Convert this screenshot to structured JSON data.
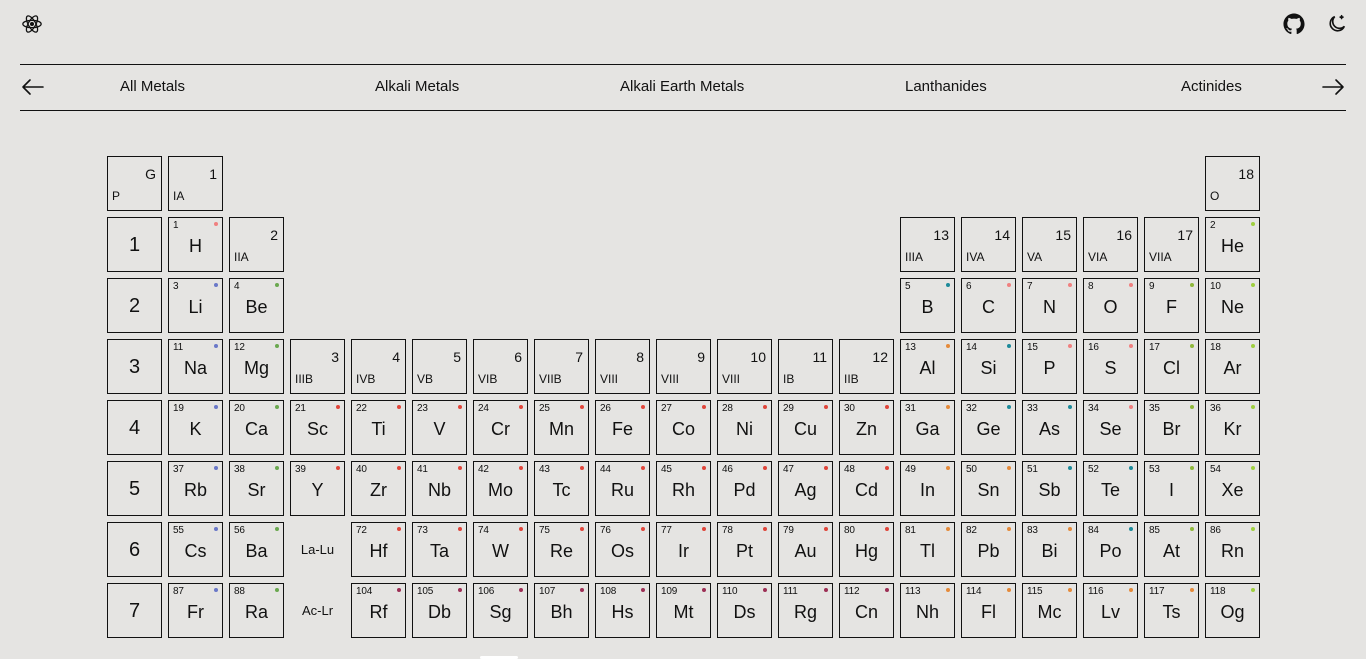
{
  "categories": [
    "All Metals",
    "Alkali Metals",
    "Alkali Earth Metals",
    "Lanthanides",
    "Actinides"
  ],
  "colors": {
    "alkali": "#6a78c8",
    "alkaline": "#6aa84f",
    "transition": "#e0453a",
    "post_transition": "#e58a3a",
    "metalloid": "#1d8a9a",
    "nonmetal": "#f08080",
    "halogen": "#8fb83a",
    "noble": "#9fcf3f",
    "superheavy": "#9c2f55"
  },
  "corner": {
    "top": "G",
    "bottom": "P"
  },
  "group_18_header": {
    "num": "18",
    "group": "O"
  },
  "group_headers": [
    {
      "num": "1",
      "group": "IA",
      "col": 1,
      "row": 0
    },
    {
      "num": "2",
      "group": "IIA",
      "col": 2,
      "row": 1
    },
    {
      "num": "3",
      "group": "IIIB",
      "col": 3,
      "row": 3
    },
    {
      "num": "4",
      "group": "IVB",
      "col": 4,
      "row": 3
    },
    {
      "num": "5",
      "group": "VB",
      "col": 5,
      "row": 3
    },
    {
      "num": "6",
      "group": "VIB",
      "col": 6,
      "row": 3
    },
    {
      "num": "7",
      "group": "VIIB",
      "col": 7,
      "row": 3
    },
    {
      "num": "8",
      "group": "VIII",
      "col": 8,
      "row": 3
    },
    {
      "num": "9",
      "group": "VIII",
      "col": 9,
      "row": 3
    },
    {
      "num": "10",
      "group": "VIII",
      "col": 10,
      "row": 3
    },
    {
      "num": "11",
      "group": "IB",
      "col": 11,
      "row": 3
    },
    {
      "num": "12",
      "group": "IIB",
      "col": 12,
      "row": 3
    },
    {
      "num": "13",
      "group": "IIIA",
      "col": 13,
      "row": 1
    },
    {
      "num": "14",
      "group": "IVA",
      "col": 14,
      "row": 1
    },
    {
      "num": "15",
      "group": "VA",
      "col": 15,
      "row": 1
    },
    {
      "num": "16",
      "group": "VIA",
      "col": 16,
      "row": 1
    },
    {
      "num": "17",
      "group": "VIIA",
      "col": 17,
      "row": 1
    }
  ],
  "periods": [
    "1",
    "2",
    "3",
    "4",
    "5",
    "6",
    "7"
  ],
  "range_labels": [
    {
      "label": "La-Lu",
      "col": 3,
      "row": 6
    },
    {
      "label": "Ac-Lr",
      "col": 3,
      "row": 7
    }
  ],
  "elements": [
    {
      "n": "1",
      "s": "H",
      "col": 1,
      "row": 1,
      "c": "nonmetal"
    },
    {
      "n": "2",
      "s": "He",
      "col": 18,
      "row": 1,
      "c": "noble"
    },
    {
      "n": "3",
      "s": "Li",
      "col": 1,
      "row": 2,
      "c": "alkali"
    },
    {
      "n": "4",
      "s": "Be",
      "col": 2,
      "row": 2,
      "c": "alkaline"
    },
    {
      "n": "5",
      "s": "B",
      "col": 13,
      "row": 2,
      "c": "metalloid"
    },
    {
      "n": "6",
      "s": "C",
      "col": 14,
      "row": 2,
      "c": "nonmetal"
    },
    {
      "n": "7",
      "s": "N",
      "col": 15,
      "row": 2,
      "c": "nonmetal"
    },
    {
      "n": "8",
      "s": "O",
      "col": 16,
      "row": 2,
      "c": "nonmetal"
    },
    {
      "n": "9",
      "s": "F",
      "col": 17,
      "row": 2,
      "c": "halogen"
    },
    {
      "n": "10",
      "s": "Ne",
      "col": 18,
      "row": 2,
      "c": "noble"
    },
    {
      "n": "11",
      "s": "Na",
      "col": 1,
      "row": 3,
      "c": "alkali"
    },
    {
      "n": "12",
      "s": "Mg",
      "col": 2,
      "row": 3,
      "c": "alkaline"
    },
    {
      "n": "13",
      "s": "Al",
      "col": 13,
      "row": 3,
      "c": "post_transition"
    },
    {
      "n": "14",
      "s": "Si",
      "col": 14,
      "row": 3,
      "c": "metalloid"
    },
    {
      "n": "15",
      "s": "P",
      "col": 15,
      "row": 3,
      "c": "nonmetal"
    },
    {
      "n": "16",
      "s": "S",
      "col": 16,
      "row": 3,
      "c": "nonmetal"
    },
    {
      "n": "17",
      "s": "Cl",
      "col": 17,
      "row": 3,
      "c": "halogen"
    },
    {
      "n": "18",
      "s": "Ar",
      "col": 18,
      "row": 3,
      "c": "noble"
    },
    {
      "n": "19",
      "s": "K",
      "col": 1,
      "row": 4,
      "c": "alkali"
    },
    {
      "n": "20",
      "s": "Ca",
      "col": 2,
      "row": 4,
      "c": "alkaline"
    },
    {
      "n": "21",
      "s": "Sc",
      "col": 3,
      "row": 4,
      "c": "transition"
    },
    {
      "n": "22",
      "s": "Ti",
      "col": 4,
      "row": 4,
      "c": "transition"
    },
    {
      "n": "23",
      "s": "V",
      "col": 5,
      "row": 4,
      "c": "transition"
    },
    {
      "n": "24",
      "s": "Cr",
      "col": 6,
      "row": 4,
      "c": "transition"
    },
    {
      "n": "25",
      "s": "Mn",
      "col": 7,
      "row": 4,
      "c": "transition"
    },
    {
      "n": "26",
      "s": "Fe",
      "col": 8,
      "row": 4,
      "c": "transition"
    },
    {
      "n": "27",
      "s": "Co",
      "col": 9,
      "row": 4,
      "c": "transition"
    },
    {
      "n": "28",
      "s": "Ni",
      "col": 10,
      "row": 4,
      "c": "transition"
    },
    {
      "n": "29",
      "s": "Cu",
      "col": 11,
      "row": 4,
      "c": "transition"
    },
    {
      "n": "30",
      "s": "Zn",
      "col": 12,
      "row": 4,
      "c": "transition"
    },
    {
      "n": "31",
      "s": "Ga",
      "col": 13,
      "row": 4,
      "c": "post_transition"
    },
    {
      "n": "32",
      "s": "Ge",
      "col": 14,
      "row": 4,
      "c": "metalloid"
    },
    {
      "n": "33",
      "s": "As",
      "col": 15,
      "row": 4,
      "c": "metalloid"
    },
    {
      "n": "34",
      "s": "Se",
      "col": 16,
      "row": 4,
      "c": "nonmetal"
    },
    {
      "n": "35",
      "s": "Br",
      "col": 17,
      "row": 4,
      "c": "halogen"
    },
    {
      "n": "36",
      "s": "Kr",
      "col": 18,
      "row": 4,
      "c": "noble"
    },
    {
      "n": "37",
      "s": "Rb",
      "col": 1,
      "row": 5,
      "c": "alkali"
    },
    {
      "n": "38",
      "s": "Sr",
      "col": 2,
      "row": 5,
      "c": "alkaline"
    },
    {
      "n": "39",
      "s": "Y",
      "col": 3,
      "row": 5,
      "c": "transition"
    },
    {
      "n": "40",
      "s": "Zr",
      "col": 4,
      "row": 5,
      "c": "transition"
    },
    {
      "n": "41",
      "s": "Nb",
      "col": 5,
      "row": 5,
      "c": "transition"
    },
    {
      "n": "42",
      "s": "Mo",
      "col": 6,
      "row": 5,
      "c": "transition"
    },
    {
      "n": "43",
      "s": "Tc",
      "col": 7,
      "row": 5,
      "c": "transition"
    },
    {
      "n": "44",
      "s": "Ru",
      "col": 8,
      "row": 5,
      "c": "transition"
    },
    {
      "n": "45",
      "s": "Rh",
      "col": 9,
      "row": 5,
      "c": "transition"
    },
    {
      "n": "46",
      "s": "Pd",
      "col": 10,
      "row": 5,
      "c": "transition"
    },
    {
      "n": "47",
      "s": "Ag",
      "col": 11,
      "row": 5,
      "c": "transition"
    },
    {
      "n": "48",
      "s": "Cd",
      "col": 12,
      "row": 5,
      "c": "transition"
    },
    {
      "n": "49",
      "s": "In",
      "col": 13,
      "row": 5,
      "c": "post_transition"
    },
    {
      "n": "50",
      "s": "Sn",
      "col": 14,
      "row": 5,
      "c": "post_transition"
    },
    {
      "n": "51",
      "s": "Sb",
      "col": 15,
      "row": 5,
      "c": "metalloid"
    },
    {
      "n": "52",
      "s": "Te",
      "col": 16,
      "row": 5,
      "c": "metalloid"
    },
    {
      "n": "53",
      "s": "I",
      "col": 17,
      "row": 5,
      "c": "halogen"
    },
    {
      "n": "54",
      "s": "Xe",
      "col": 18,
      "row": 5,
      "c": "noble"
    },
    {
      "n": "55",
      "s": "Cs",
      "col": 1,
      "row": 6,
      "c": "alkali"
    },
    {
      "n": "56",
      "s": "Ba",
      "col": 2,
      "row": 6,
      "c": "alkaline"
    },
    {
      "n": "72",
      "s": "Hf",
      "col": 4,
      "row": 6,
      "c": "transition"
    },
    {
      "n": "73",
      "s": "Ta",
      "col": 5,
      "row": 6,
      "c": "transition"
    },
    {
      "n": "74",
      "s": "W",
      "col": 6,
      "row": 6,
      "c": "transition"
    },
    {
      "n": "75",
      "s": "Re",
      "col": 7,
      "row": 6,
      "c": "transition"
    },
    {
      "n": "76",
      "s": "Os",
      "col": 8,
      "row": 6,
      "c": "transition"
    },
    {
      "n": "77",
      "s": "Ir",
      "col": 9,
      "row": 6,
      "c": "transition"
    },
    {
      "n": "78",
      "s": "Pt",
      "col": 10,
      "row": 6,
      "c": "transition"
    },
    {
      "n": "79",
      "s": "Au",
      "col": 11,
      "row": 6,
      "c": "transition"
    },
    {
      "n": "80",
      "s": "Hg",
      "col": 12,
      "row": 6,
      "c": "transition"
    },
    {
      "n": "81",
      "s": "Tl",
      "col": 13,
      "row": 6,
      "c": "post_transition"
    },
    {
      "n": "82",
      "s": "Pb",
      "col": 14,
      "row": 6,
      "c": "post_transition"
    },
    {
      "n": "83",
      "s": "Bi",
      "col": 15,
      "row": 6,
      "c": "post_transition"
    },
    {
      "n": "84",
      "s": "Po",
      "col": 16,
      "row": 6,
      "c": "metalloid"
    },
    {
      "n": "85",
      "s": "At",
      "col": 17,
      "row": 6,
      "c": "halogen"
    },
    {
      "n": "86",
      "s": "Rn",
      "col": 18,
      "row": 6,
      "c": "noble"
    },
    {
      "n": "87",
      "s": "Fr",
      "col": 1,
      "row": 7,
      "c": "alkali"
    },
    {
      "n": "88",
      "s": "Ra",
      "col": 2,
      "row": 7,
      "c": "alkaline"
    },
    {
      "n": "104",
      "s": "Rf",
      "col": 4,
      "row": 7,
      "c": "superheavy"
    },
    {
      "n": "105",
      "s": "Db",
      "col": 5,
      "row": 7,
      "c": "superheavy"
    },
    {
      "n": "106",
      "s": "Sg",
      "col": 6,
      "row": 7,
      "c": "superheavy"
    },
    {
      "n": "107",
      "s": "Bh",
      "col": 7,
      "row": 7,
      "c": "superheavy"
    },
    {
      "n": "108",
      "s": "Hs",
      "col": 8,
      "row": 7,
      "c": "superheavy"
    },
    {
      "n": "109",
      "s": "Mt",
      "col": 9,
      "row": 7,
      "c": "superheavy"
    },
    {
      "n": "110",
      "s": "Ds",
      "col": 10,
      "row": 7,
      "c": "superheavy"
    },
    {
      "n": "111",
      "s": "Rg",
      "col": 11,
      "row": 7,
      "c": "superheavy"
    },
    {
      "n": "112",
      "s": "Cn",
      "col": 12,
      "row": 7,
      "c": "superheavy"
    },
    {
      "n": "113",
      "s": "Nh",
      "col": 13,
      "row": 7,
      "c": "post_transition"
    },
    {
      "n": "114",
      "s": "Fl",
      "col": 14,
      "row": 7,
      "c": "post_transition"
    },
    {
      "n": "115",
      "s": "Mc",
      "col": 15,
      "row": 7,
      "c": "post_transition"
    },
    {
      "n": "116",
      "s": "Lv",
      "col": 16,
      "row": 7,
      "c": "post_transition"
    },
    {
      "n": "117",
      "s": "Ts",
      "col": 17,
      "row": 7,
      "c": "post_transition"
    },
    {
      "n": "118",
      "s": "Og",
      "col": 18,
      "row": 7,
      "c": "noble"
    }
  ]
}
